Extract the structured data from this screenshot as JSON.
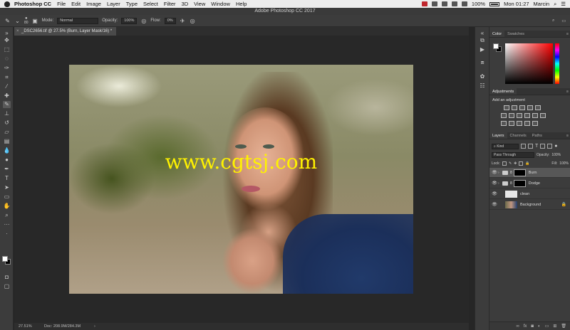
{
  "menubar": {
    "app_name": "Photoshop CC",
    "items": [
      "File",
      "Edit",
      "Image",
      "Layer",
      "Type",
      "Select",
      "Filter",
      "3D",
      "View",
      "Window",
      "Help"
    ],
    "battery": "100%",
    "clock": "Mon 01:27",
    "user": "Marcin"
  },
  "window": {
    "title": "Adobe Photoshop CC 2017"
  },
  "options": {
    "brush_size": "80",
    "mode_label": "Mode:",
    "mode_value": "Normal",
    "opacity_label": "Opacity:",
    "opacity_value": "100%",
    "flow_label": "Flow:",
    "flow_value": "0%"
  },
  "document": {
    "tab_title": "_DSC2656.tif @ 27.5% (Burn, Layer Mask/16) *",
    "watermark": "www.cgtsj.com",
    "zoom": "27.51%",
    "doc_size": "Doc: 208.9M/284.3M"
  },
  "color_panel": {
    "tabs": [
      "Color",
      "Swatches"
    ]
  },
  "adjustments_panel": {
    "title": "Adjustments",
    "hint": "Add an adjustment"
  },
  "layers_panel": {
    "tabs": [
      "Layers",
      "Channels",
      "Paths"
    ],
    "filter_kind": "Kind",
    "blend_mode": "Pass Through",
    "opacity_label": "Opacity:",
    "opacity_value": "100%",
    "lock_label": "Lock:",
    "fill_label": "Fill:",
    "fill_value": "100%",
    "layers": [
      {
        "name": "Burn",
        "type": "group",
        "selected": true
      },
      {
        "name": "Dodge",
        "type": "group",
        "selected": false
      },
      {
        "name": "clean",
        "type": "pixel",
        "selected": false
      },
      {
        "name": "Background",
        "type": "background",
        "selected": false
      }
    ]
  }
}
